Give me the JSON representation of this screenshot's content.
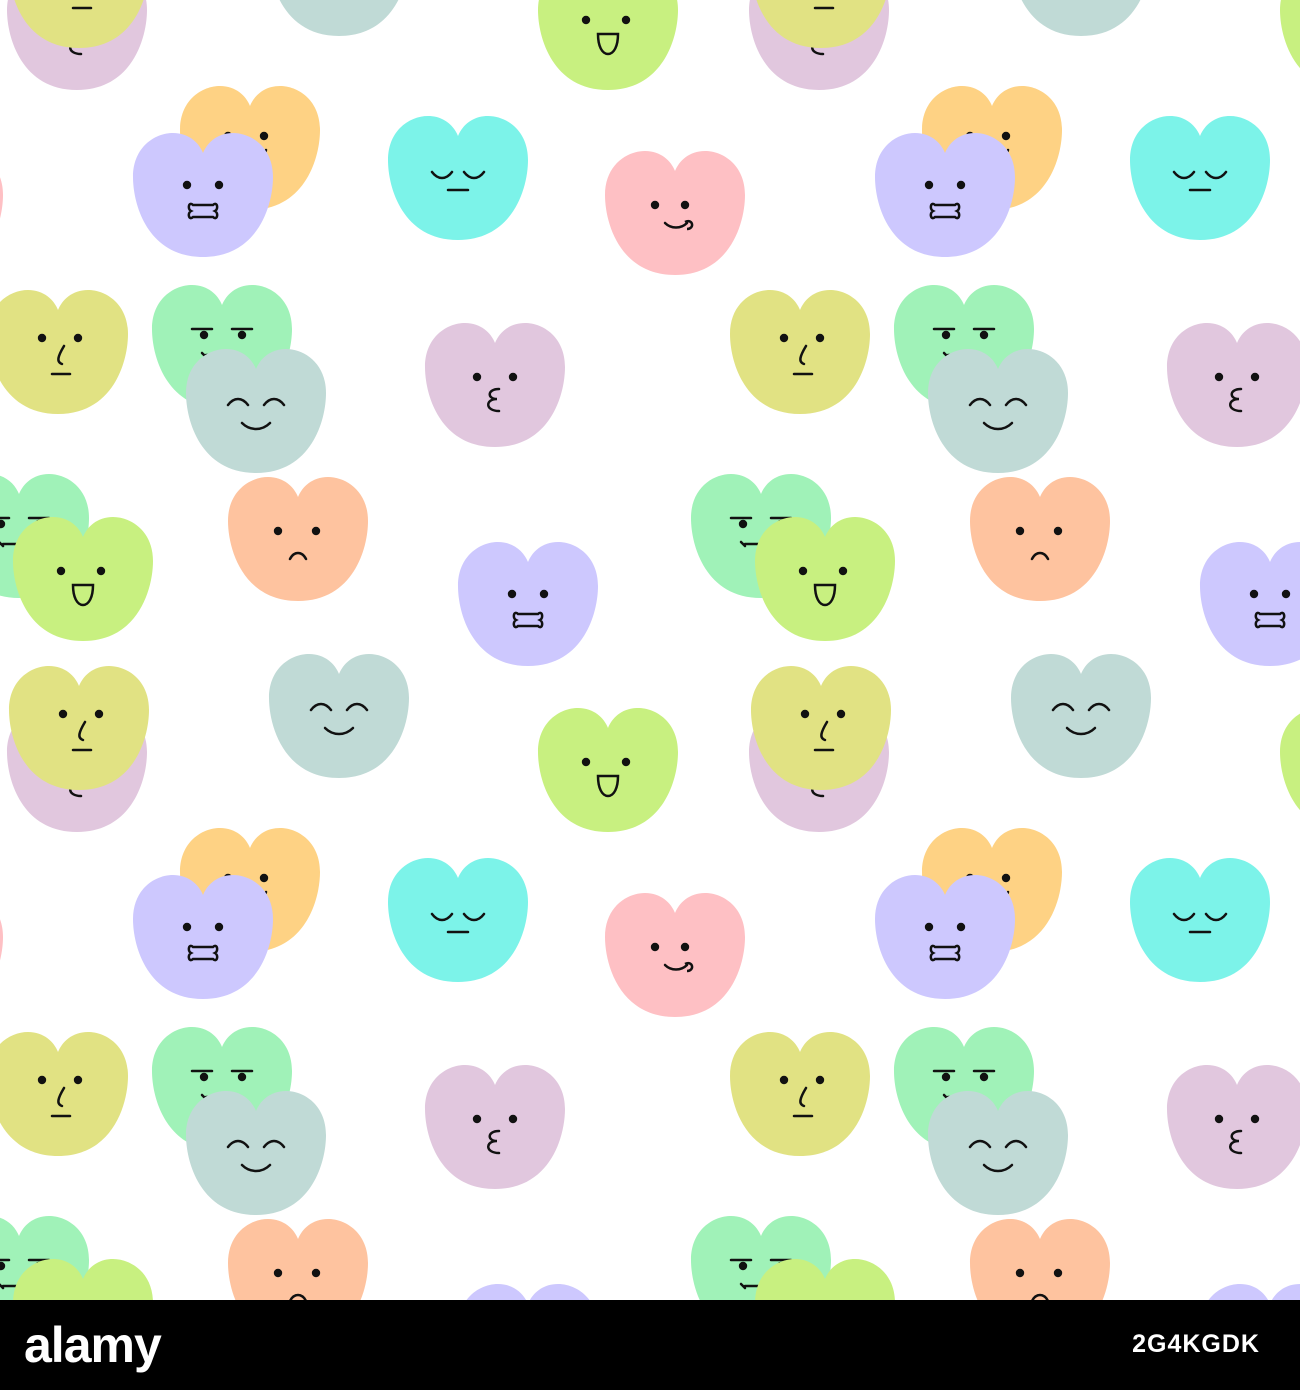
{
  "footer": {
    "brand": "alamy",
    "image_id": "2G4KGDK",
    "info_line": ""
  },
  "pattern": {
    "background": "#ffffff",
    "colors": {
      "mint": "#a0f2b8",
      "lime": "#c8f080",
      "orange": "#fed284",
      "peach": "#fec39f",
      "cyan": "#7cf3e9",
      "pink": "#fec0c4",
      "lavender": "#cdc8fe",
      "mauve": "#e1c7de",
      "sage": "#c0dad6",
      "olive": "#e1e283"
    },
    "faces": [
      "kiss",
      "happy",
      "cat",
      "serene",
      "tongue",
      "bite",
      "unamused",
      "smirk",
      "smile",
      "frown"
    ]
  }
}
